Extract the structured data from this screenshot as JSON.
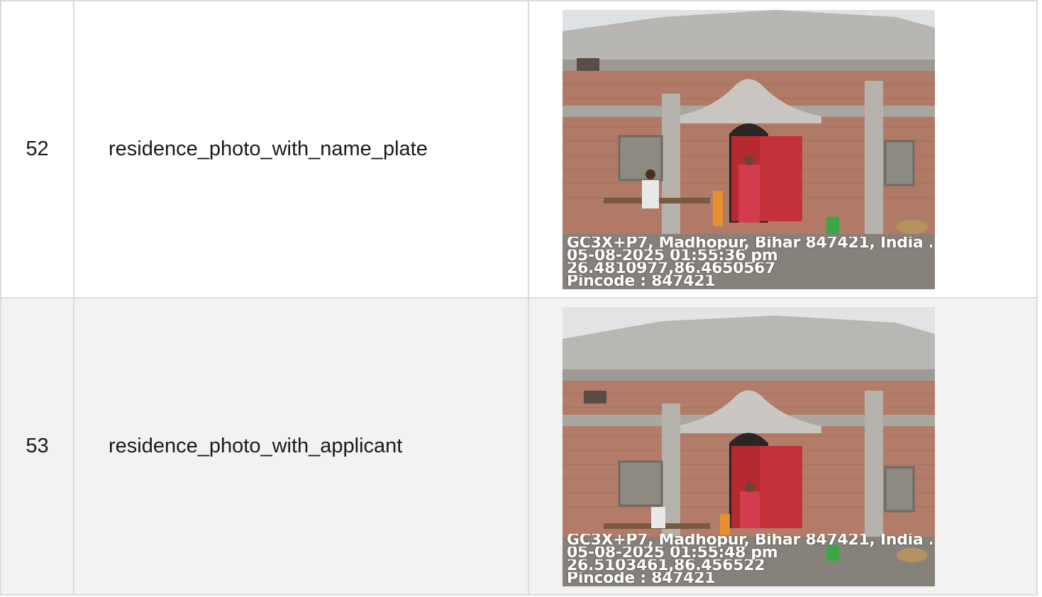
{
  "rows": [
    {
      "number": "52",
      "field": "residence_photo_with_name_plate",
      "photo": {
        "description_icon": "house-photo",
        "overlay": {
          "line1": "GC3X+P7, Madhopur, Bihar 847421, India ...",
          "line2": "05-08-2025 01:55:36 pm",
          "line3": "26.4810977,86.4650567",
          "line4": "Pincode : 847421"
        }
      }
    },
    {
      "number": "53",
      "field": "residence_photo_with_applicant",
      "photo": {
        "description_icon": "house-photo",
        "overlay": {
          "line1": "GC3X+P7, Madhopur, Bihar 847421, India ...",
          "line2": "05-08-2025 01:55:48 pm",
          "line3": "26.5103461,86.456522",
          "line4": "Pincode : 847421"
        }
      }
    }
  ],
  "colors": {
    "row_odd_bg": "#ffffff",
    "row_even_bg": "#f2f2f2",
    "border": "#dcdcdc"
  }
}
